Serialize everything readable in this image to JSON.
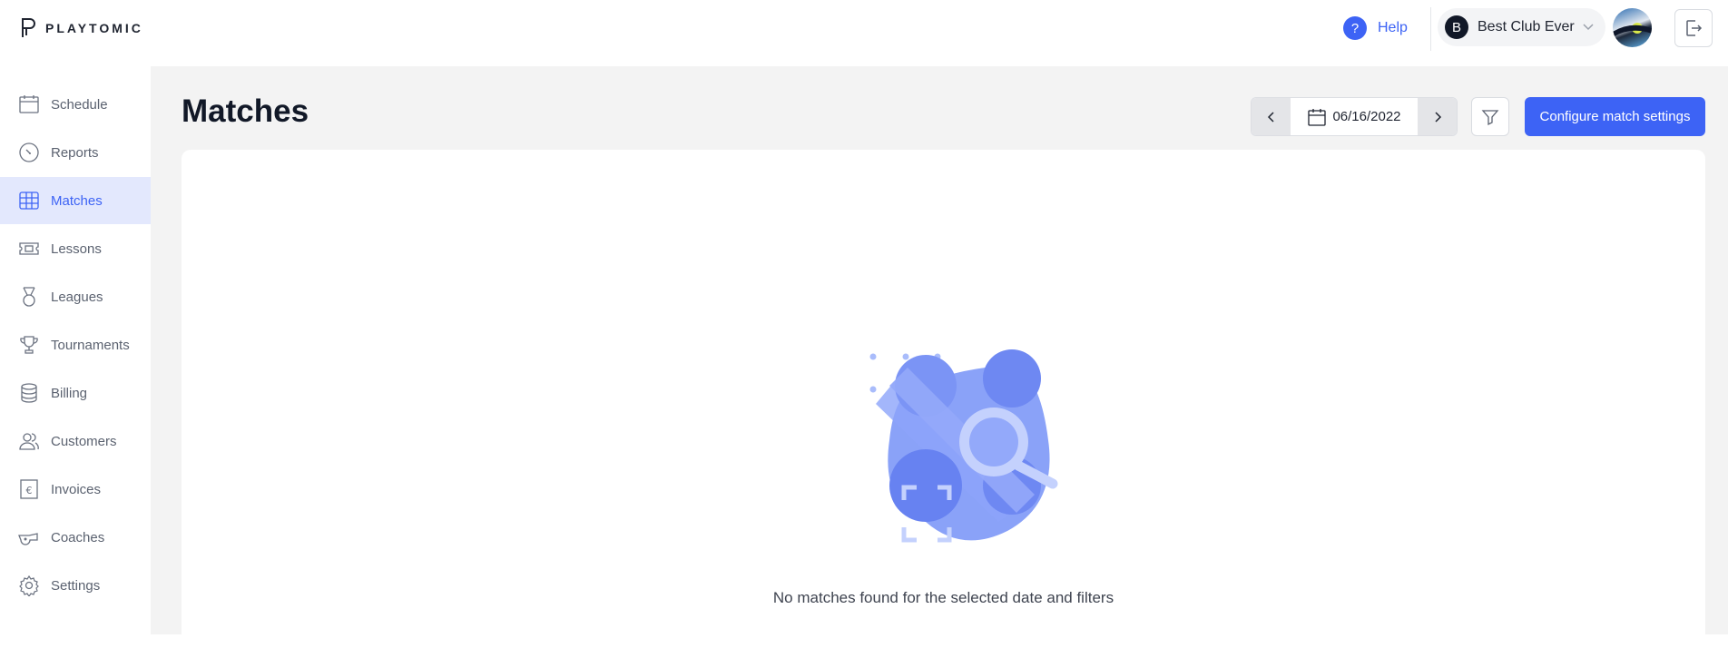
{
  "header": {
    "logo_text": "PLAYTOMIC",
    "help_label": "Help",
    "club": {
      "initial": "B",
      "name": "Best Club Ever"
    }
  },
  "sidebar": {
    "items": [
      {
        "label": "Schedule",
        "icon": "calendar-icon",
        "active": false
      },
      {
        "label": "Reports",
        "icon": "gauge-icon",
        "active": false
      },
      {
        "label": "Matches",
        "icon": "grid-icon",
        "active": true
      },
      {
        "label": "Lessons",
        "icon": "ticket-icon",
        "active": false
      },
      {
        "label": "Leagues",
        "icon": "medal-icon",
        "active": false
      },
      {
        "label": "Tournaments",
        "icon": "trophy-icon",
        "active": false
      },
      {
        "label": "Billing",
        "icon": "coins-icon",
        "active": false
      },
      {
        "label": "Customers",
        "icon": "users-icon",
        "active": false
      },
      {
        "label": "Invoices",
        "icon": "euro-doc-icon",
        "active": false
      },
      {
        "label": "Coaches",
        "icon": "whistle-icon",
        "active": false
      },
      {
        "label": "Settings",
        "icon": "gear-icon",
        "active": false
      }
    ]
  },
  "main": {
    "title": "Matches",
    "date": "06/16/2022",
    "config_label": "Configure match settings",
    "empty_message": "No matches found for the selected date and filters"
  },
  "colors": {
    "accent": "#3d63f5",
    "active_nav_bg": "#e3e8fd",
    "content_bg": "#f3f3f3"
  }
}
